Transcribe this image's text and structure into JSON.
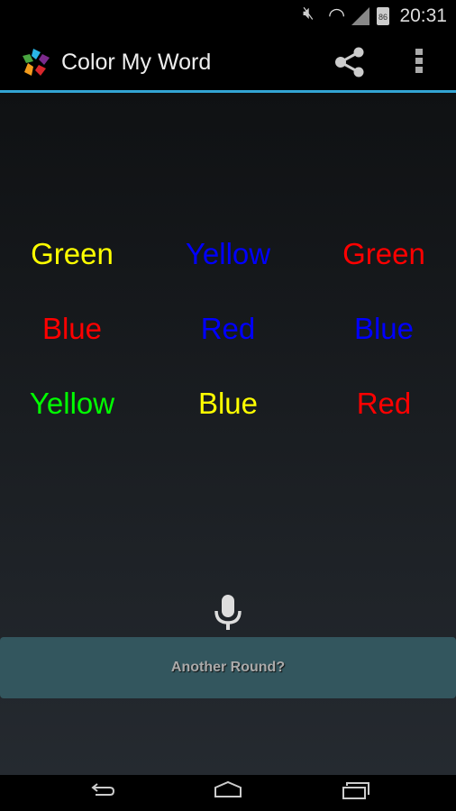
{
  "status_bar": {
    "time": "20:31",
    "battery": "86",
    "icons": [
      "mute-icon",
      "wifi-icon",
      "signal-icon",
      "battery-icon"
    ]
  },
  "action_bar": {
    "title": "Color My Word",
    "actions": [
      "share-icon",
      "overflow-menu-icon"
    ],
    "accent": "#33a5d4"
  },
  "words": [
    [
      {
        "text": "Green",
        "color": "#ffff00"
      },
      {
        "text": "Yellow",
        "color": "#0000ff"
      },
      {
        "text": "Green",
        "color": "#ff0000"
      }
    ],
    [
      {
        "text": "Blue",
        "color": "#ff0000"
      },
      {
        "text": "Red",
        "color": "#0000ff"
      },
      {
        "text": "Blue",
        "color": "#0000ff"
      }
    ],
    [
      {
        "text": "Yellow",
        "color": "#00ff00"
      },
      {
        "text": "Blue",
        "color": "#ffff00"
      },
      {
        "text": "Red",
        "color": "#ff0000"
      }
    ]
  ],
  "another_round_label": "Another Round?",
  "button_color": "#33565e"
}
